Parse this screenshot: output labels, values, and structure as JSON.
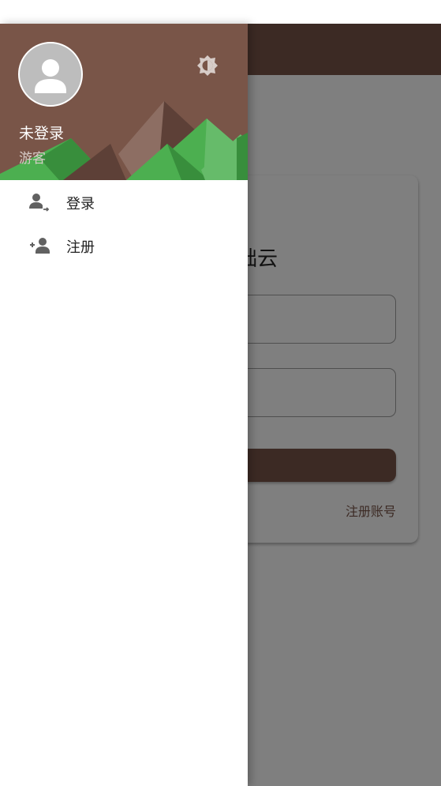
{
  "underlay": {
    "card_title_partial": "础云",
    "register_link": "注册账号"
  },
  "drawer": {
    "user_name": "未登录",
    "user_role": "游客",
    "theme_toggle_icon": "brightness-icon",
    "menu": [
      {
        "label": "登录",
        "icon": "login-icon"
      },
      {
        "label": "注册",
        "icon": "person-add-icon"
      }
    ]
  },
  "colors": {
    "brand_brown": "#795548",
    "dark_brown": "#5d4037",
    "green": "#4caf50",
    "light_green": "#66bb6a",
    "dark_green": "#388e3c"
  }
}
